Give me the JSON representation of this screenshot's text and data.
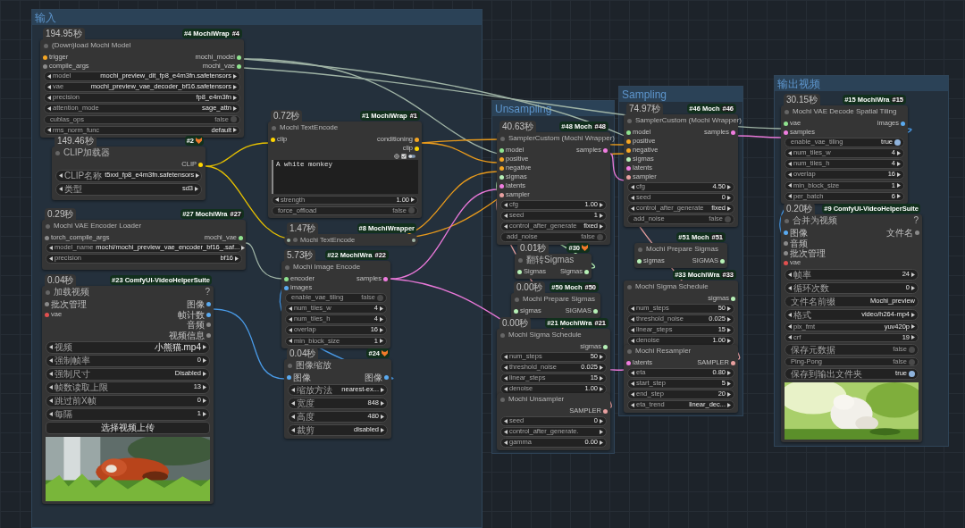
{
  "groups": [
    {
      "title": "输入"
    },
    {
      "title": "Unsampling"
    },
    {
      "title": "Sampling"
    },
    {
      "title": "输出视频"
    }
  ],
  "nodes": [
    {
      "kind": "full",
      "time": "194.95秒",
      "badge": "#4 MochiWrap",
      "badge_id": "#4",
      "title": "(Down)load Mochi Model",
      "inputs": [
        {
          "label": "trigger",
          "color": "#f5a623"
        },
        {
          "label": "compile_args",
          "color": "#8a8a8a"
        }
      ],
      "outputs": [
        {
          "label": "mochi_model",
          "color": "#8fe38f"
        },
        {
          "label": "mochi_vae",
          "color": "#8fe38f"
        }
      ],
      "widgets": [
        {
          "kind": "combo",
          "label": "model",
          "value": "mochi_preview_dit_fp8_e4m3fn.safetensors"
        },
        {
          "kind": "combo",
          "label": "vae",
          "value": "mochi_preview_vae_decoder_bf16.safetensors"
        },
        {
          "kind": "combo",
          "label": "precision",
          "value": "fp8_e4m3fn"
        },
        {
          "kind": "combo",
          "label": "attention_mode",
          "value": "sage_attn"
        },
        {
          "kind": "toggle",
          "label": "cublas_ops",
          "value": "false",
          "on": false
        },
        {
          "kind": "combo",
          "label": "rms_norm_func",
          "value": "default"
        }
      ]
    },
    {
      "kind": "full",
      "time": "149.46秒",
      "badge": "#2",
      "badge_icon": true,
      "title": "CLIP加载器",
      "outputs": [
        {
          "label": "CLIP",
          "color": "#ffd500"
        }
      ],
      "widgets": [
        {
          "kind": "combo",
          "label": "CLIP名称",
          "value": "t5xxl_fp8_e4m3fn.safetensors"
        },
        {
          "kind": "combo",
          "label": "类型",
          "value": "sd3"
        }
      ]
    },
    {
      "kind": "full",
      "time": "0.29秒",
      "badge": "#27 MochiWra",
      "badge_id": "#27",
      "title": "Mochi VAE Encoder Loader",
      "inputs": [
        {
          "label": "torch_compile_args",
          "color": "#8a8a8a"
        }
      ],
      "outputs": [
        {
          "label": "mochi_vae",
          "color": "#8fe38f"
        }
      ],
      "widgets": [
        {
          "kind": "combo",
          "label": "model_name",
          "value": "mochi/mochi_preview_vae_encoder_bf16_.saf..."
        },
        {
          "kind": "combo",
          "label": "precision",
          "value": "bf16"
        }
      ]
    },
    {
      "kind": "full",
      "time": "0.04秒",
      "badge": "#23 ComfyUI-VideoHelperSuite",
      "title": "加载视频",
      "help": "?",
      "inputs": [
        {
          "label": "批次管理",
          "color": "#8a8a8a"
        },
        {
          "label": "vae",
          "color": "#e05050"
        }
      ],
      "outputs": [
        {
          "label": "图像",
          "color": "#5aaaf0"
        },
        {
          "label": "帧计数",
          "color": "#5aaaf0"
        },
        {
          "label": "音频",
          "color": "#8a8a8a"
        },
        {
          "label": "视频信息",
          "color": "#8a8a8a"
        }
      ],
      "widgets": [
        {
          "kind": "combo",
          "label": "视频",
          "value": "小熊猫.mp4"
        },
        {
          "kind": "number",
          "label": "强制帧率",
          "value": "0"
        },
        {
          "kind": "combo",
          "label": "强制尺寸",
          "value": "Disabled"
        },
        {
          "kind": "number",
          "label": "帧数读取上限",
          "value": "13"
        },
        {
          "kind": "number",
          "label": "跳过前X帧",
          "value": "0"
        },
        {
          "kind": "number",
          "label": "每隔",
          "value": "1"
        },
        {
          "kind": "button",
          "label": "选择视频上传"
        }
      ],
      "preview": {
        "kind": "picture"
      }
    },
    {
      "kind": "full",
      "time": "0.72秒",
      "badge": "#1 MochiWrap",
      "badge_id": "#1",
      "title": "Mochi TextEncode",
      "inputs": [
        {
          "label": "clip",
          "color": "#ffd500"
        }
      ],
      "outputs": [
        {
          "label": "conditioning",
          "color": "#f5a623"
        },
        {
          "label": "clip",
          "color": "#ffd500"
        }
      ],
      "widgets": [
        {
          "kind": "textarea",
          "value": "A white monkey"
        },
        {
          "kind": "number",
          "label": "strength",
          "value": "1.00"
        },
        {
          "kind": "toggle",
          "label": "force_offload",
          "value": "false",
          "on": false
        }
      ]
    },
    {
      "kind": "collapsed",
      "time": "1.47秒",
      "badge": "#8 MochiWrapper",
      "title": "Mochi TextEncode"
    },
    {
      "kind": "full",
      "time": "5.73秒",
      "badge": "#22 MochiWra",
      "badge_id": "#22",
      "title": "Mochi Image Encode",
      "inputs": [
        {
          "label": "encoder",
          "color": "#8fe38f"
        },
        {
          "label": "images",
          "color": "#5aaaf0"
        }
      ],
      "outputs": [
        {
          "label": "samples",
          "color": "#f07de0"
        }
      ],
      "widgets": [
        {
          "kind": "toggle",
          "label": "enable_vae_tiling",
          "value": "false",
          "on": false
        },
        {
          "kind": "number",
          "label": "num_tiles_w",
          "value": "4"
        },
        {
          "kind": "number",
          "label": "num_tiles_h",
          "value": "4"
        },
        {
          "kind": "number",
          "label": "overlap",
          "value": "16"
        },
        {
          "kind": "number",
          "label": "min_block_size",
          "value": "1"
        }
      ]
    },
    {
      "kind": "full",
      "time": "0.04秒",
      "badge": "#24",
      "badge_icon": true,
      "title": "图像缩放",
      "inputs": [
        {
          "label": "图像",
          "color": "#5aaaf0"
        }
      ],
      "outputs": [
        {
          "label": "图像",
          "color": "#5aaaf0"
        }
      ],
      "widgets": [
        {
          "kind": "combo",
          "label": "缩放方法",
          "value": "nearest-ex..."
        },
        {
          "kind": "number",
          "label": "宽度",
          "value": "848"
        },
        {
          "kind": "number",
          "label": "高度",
          "value": "480"
        },
        {
          "kind": "combo",
          "label": "裁剪",
          "value": "disabled"
        }
      ]
    },
    {
      "kind": "full",
      "time": "40.63秒",
      "badge": "#48 Moch",
      "badge_id": "#48",
      "title": "SamplerCustom (Mochi Wrapper)",
      "inputs": [
        {
          "label": "model",
          "color": "#8fe38f"
        },
        {
          "label": "positive",
          "color": "#f5a623"
        },
        {
          "label": "negative",
          "color": "#f5a623"
        },
        {
          "label": "sigmas",
          "color": "#b6f0b6"
        },
        {
          "label": "latents",
          "color": "#f07de0"
        },
        {
          "label": "sampler",
          "color": "#e8a0a0"
        }
      ],
      "outputs": [
        {
          "label": "samples",
          "color": "#f07de0"
        }
      ],
      "widgets": [
        {
          "kind": "number",
          "label": "cfg",
          "value": "1.00"
        },
        {
          "kind": "number",
          "label": "seed",
          "value": "1"
        },
        {
          "kind": "combo",
          "label": "control_after_generate",
          "value": "fixed"
        },
        {
          "kind": "toggle",
          "label": "add_noise",
          "value": "false",
          "on": false
        }
      ]
    },
    {
      "kind": "full",
      "time": "0.01秒",
      "badge": "#30",
      "badge_icon": true,
      "title": "翻转Sigmas",
      "inputs": [
        {
          "label": "Sigmas",
          "color": "#b6f0b6"
        }
      ],
      "outputs": [
        {
          "label": "Sigmas",
          "color": "#b6f0b6"
        }
      ]
    },
    {
      "kind": "full",
      "time": "0.00秒",
      "badge": "#50 Moch",
      "badge_id": "#50",
      "title": "Mochi Prepare Sigmas",
      "inputs": [
        {
          "label": "sigmas",
          "color": "#b6f0b6"
        }
      ],
      "outputs": [
        {
          "label": "SIGMAS",
          "color": "#b6f0b6"
        }
      ]
    },
    {
      "kind": "full",
      "time": "0.00秒",
      "badge": "#21 MochiWra",
      "badge_id": "#21",
      "title": "Mochi Sigma Schedule",
      "outputs": [
        {
          "label": "sigmas",
          "color": "#b6f0b6"
        }
      ],
      "widgets": [
        {
          "kind": "number",
          "label": "num_steps",
          "value": "50"
        },
        {
          "kind": "number",
          "label": "threshold_noise",
          "value": "0.025"
        },
        {
          "kind": "number",
          "label": "linear_steps",
          "value": "15"
        },
        {
          "kind": "number",
          "label": "denoise",
          "value": "1.00"
        }
      ]
    },
    {
      "kind": "full",
      "title": "Mochi Unsampler",
      "outputs": [
        {
          "label": "SAMPLER",
          "color": "#e8a0a0"
        }
      ],
      "widgets": [
        {
          "kind": "number",
          "label": "seed",
          "value": "0"
        },
        {
          "kind": "combo",
          "label": "control_after_generate."
        },
        {
          "kind": "number",
          "label": "gamma",
          "value": "0.00"
        }
      ]
    },
    {
      "kind": "full",
      "time": "74.97秒",
      "badge": "#46 Moch",
      "badge_id": "#46",
      "title": "SamplerCustom (Mochi Wrapper)",
      "inputs": [
        {
          "label": "model",
          "color": "#8fe38f"
        },
        {
          "label": "positive",
          "color": "#f5a623"
        },
        {
          "label": "negative",
          "color": "#f5a623"
        },
        {
          "label": "sigmas",
          "color": "#b6f0b6"
        },
        {
          "label": "latents",
          "color": "#f07de0"
        },
        {
          "label": "sampler",
          "color": "#e8a0a0"
        }
      ],
      "outputs": [
        {
          "label": "samples",
          "color": "#f07de0"
        }
      ],
      "widgets": [
        {
          "kind": "number",
          "label": "cfg",
          "value": "4.50"
        },
        {
          "kind": "number",
          "label": "seed",
          "value": "0"
        },
        {
          "kind": "combo",
          "label": "control_after_generate",
          "value": "fixed"
        },
        {
          "kind": "toggle",
          "label": "add_noise",
          "value": "false",
          "on": false
        }
      ]
    },
    {
      "kind": "full",
      "badge": "#51 Moch",
      "badge_id": "#51",
      "title": "Mochi Prepare Sigmas",
      "inputs": [
        {
          "label": "sigmas",
          "color": "#b6f0b6"
        }
      ],
      "outputs": [
        {
          "label": "SIGMAS",
          "color": "#b6f0b6"
        }
      ]
    },
    {
      "kind": "full",
      "badge": "#33 MochiWra",
      "badge_id": "#33",
      "title": "Mochi Sigma Schedule",
      "outputs": [
        {
          "label": "sigmas",
          "color": "#b6f0b6"
        }
      ],
      "widgets": [
        {
          "kind": "number",
          "label": "num_steps",
          "value": "50"
        },
        {
          "kind": "number",
          "label": "threshold_noise",
          "value": "0.025"
        },
        {
          "kind": "number",
          "label": "linear_steps",
          "value": "15"
        },
        {
          "kind": "number",
          "label": "denoise",
          "value": "1.00"
        }
      ]
    },
    {
      "kind": "full",
      "title": "Mochi Resampler",
      "inputs": [
        {
          "label": "latents",
          "color": "#f07de0"
        }
      ],
      "outputs": [
        {
          "label": "SAMPLER",
          "color": "#e8a0a0"
        }
      ],
      "widgets": [
        {
          "kind": "number",
          "label": "eta",
          "value": "0.80"
        },
        {
          "kind": "number",
          "label": "start_step",
          "value": "5"
        },
        {
          "kind": "number",
          "label": "end_step",
          "value": "20"
        },
        {
          "kind": "combo",
          "label": "eta_trend",
          "value": "linear_dec..."
        }
      ]
    },
    {
      "kind": "full",
      "time": "30.15秒",
      "badge": "#15 MochiWra",
      "badge_id": "#15",
      "title": "Mochi VAE Decode Spatial Tiling",
      "inputs": [
        {
          "label": "vae",
          "color": "#8fe38f"
        },
        {
          "label": "samples",
          "color": "#f07de0"
        }
      ],
      "outputs": [
        {
          "label": "images",
          "color": "#5aaaf0"
        }
      ],
      "widgets": [
        {
          "kind": "toggle",
          "label": "enable_vae_tiling",
          "value": "true",
          "on": true
        },
        {
          "kind": "number",
          "label": "num_tiles_w",
          "value": "4"
        },
        {
          "kind": "number",
          "label": "num_tiles_h",
          "value": "4"
        },
        {
          "kind": "number",
          "label": "overlap",
          "value": "16"
        },
        {
          "kind": "number",
          "label": "min_block_size",
          "value": "1"
        },
        {
          "kind": "number",
          "label": "per_batch",
          "value": "6"
        }
      ]
    },
    {
      "kind": "full",
      "time": "0.20秒",
      "badge": "#9 ComfyUI-VideoHelperSuite",
      "title": "合并为视频",
      "help": "?",
      "inputs": [
        {
          "label": "图像",
          "color": "#5aaaf0"
        },
        {
          "label": "音频",
          "color": "#8a8a8a"
        },
        {
          "label": "批次管理",
          "color": "#8a8a8a"
        },
        {
          "label": "vae",
          "color": "#e05050"
        }
      ],
      "outputs": [
        {
          "label": "文件名",
          "color": "#8a8a8a"
        }
      ],
      "widgets": [
        {
          "kind": "number",
          "label": "帧率",
          "value": "24"
        },
        {
          "kind": "number",
          "label": "循环次数",
          "value": "0"
        },
        {
          "kind": "text",
          "label": "文件名前缀",
          "value": "Mochi_preview"
        },
        {
          "kind": "combo",
          "label": "格式",
          "value": "video/h264-mp4"
        },
        {
          "kind": "combo",
          "label": "pix_fmt",
          "value": "yuv420p"
        },
        {
          "kind": "number",
          "label": "crf",
          "value": "19"
        },
        {
          "kind": "toggle",
          "label": "保存元数据",
          "value": "false",
          "on": false
        },
        {
          "kind": "toggle",
          "label": "Ping-Pong",
          "value": "false",
          "on": false
        },
        {
          "kind": "toggle",
          "label": "保存到输出文件夹",
          "value": "true",
          "on": true
        }
      ],
      "preview": {
        "kind": "picture"
      }
    }
  ]
}
